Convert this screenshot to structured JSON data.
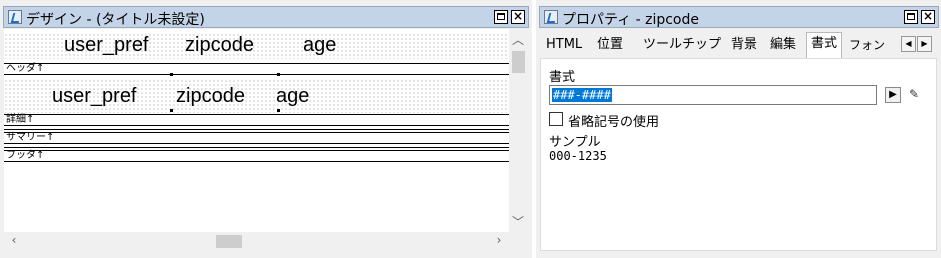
{
  "design": {
    "title": "デザイン - (タイトル未設定)",
    "header_fields": [
      "user_pref",
      "zipcode",
      "age"
    ],
    "header_label": "ヘッダ↑",
    "body_fields": [
      "user_pref",
      "zipcode",
      "age"
    ],
    "detail_label": "詳細↑",
    "summary_label": "サマリー↑",
    "footer_label": "フッタ↑"
  },
  "props": {
    "title": "プロパティ -  zipcode",
    "tabs": [
      "HTML",
      "位置",
      "ツールチップ",
      "背景",
      "編集",
      "書式",
      "フォン"
    ],
    "active_tab": "書式",
    "format_label": "書式",
    "format_value": "###-####",
    "abbrev_label": "省略記号の使用",
    "abbrev_checked": false,
    "sample_label": "サンプル",
    "sample_value": "000-1235"
  },
  "colors": {
    "title_bg": "#c4d4e8",
    "selection": "#0078d7"
  },
  "icons": [
    "window-icon",
    "maximize-icon",
    "close-icon",
    "scroll-up-icon",
    "scroll-down-icon",
    "scroll-left-icon",
    "scroll-right-icon",
    "tab-scroll-left-icon",
    "tab-scroll-right-icon",
    "arrow-right-icon",
    "edit-icon"
  ]
}
